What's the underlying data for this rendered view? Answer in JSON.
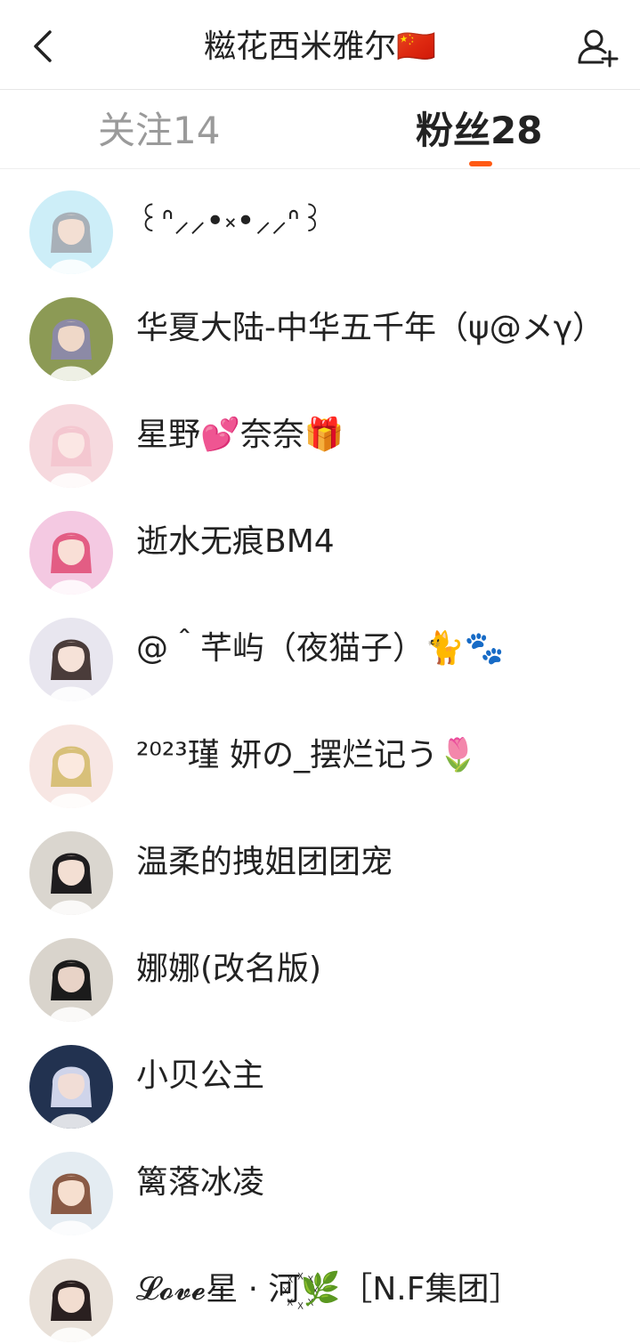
{
  "header": {
    "title": "糍花西米雅尔🇨🇳"
  },
  "tabs": {
    "follow": "关注14",
    "fans": "粉丝28"
  },
  "followers": [
    {
      "name": "꒰ᐢ⸝⸝•༝•⸝⸝ᐢ꒱",
      "bg": "#cdeef8",
      "hair": "#a8b0b8",
      "skin": "#f3dfd3"
    },
    {
      "name": "华夏大陆-中华五千年（ψ@メγ）",
      "bg": "#8c9a55",
      "hair": "#8c8aa6",
      "skin": "#efd8c8"
    },
    {
      "name": "星野💕奈奈🎁",
      "bg": "#f6d9de",
      "hair": "#f4c7d0",
      "skin": "#fbe7e4"
    },
    {
      "name": "逝水无痕BM4",
      "bg": "#f4c9e2",
      "hair": "#e35d84",
      "skin": "#f9dfd6"
    },
    {
      "name": "@＾芊屿（夜猫子）🐈🐾",
      "bg": "#e8e6ef",
      "hair": "#4a3c3a",
      "skin": "#f6e2d8"
    },
    {
      "name": "²⁰²³瑾 妍の_摆烂记う🌷",
      "bg": "#f7e6e3",
      "hair": "#d8c079",
      "skin": "#fbe9df"
    },
    {
      "name": "温柔的拽姐团团宠",
      "bg": "#dad6cf",
      "hair": "#1f1d1f",
      "skin": "#f3dfd3"
    },
    {
      "name": "娜娜(改名版)",
      "bg": "#d9d4cc",
      "hair": "#1b1b1b",
      "skin": "#e8d3c7"
    },
    {
      "name": "小贝公主",
      "bg": "#223250",
      "hair": "#cfd4ea",
      "skin": "#f1ddd6"
    },
    {
      "name": "篱落冰凌",
      "bg": "#e4ecf2",
      "hair": "#8a5a45",
      "skin": "#f6dfcf"
    },
    {
      "name": "𝓛𝓸𝓿𝓮星 · 河꙰🌿［N.F集团］",
      "bg": "#e8e0d8",
      "hair": "#2a2020",
      "skin": "#f2ddd0"
    }
  ]
}
